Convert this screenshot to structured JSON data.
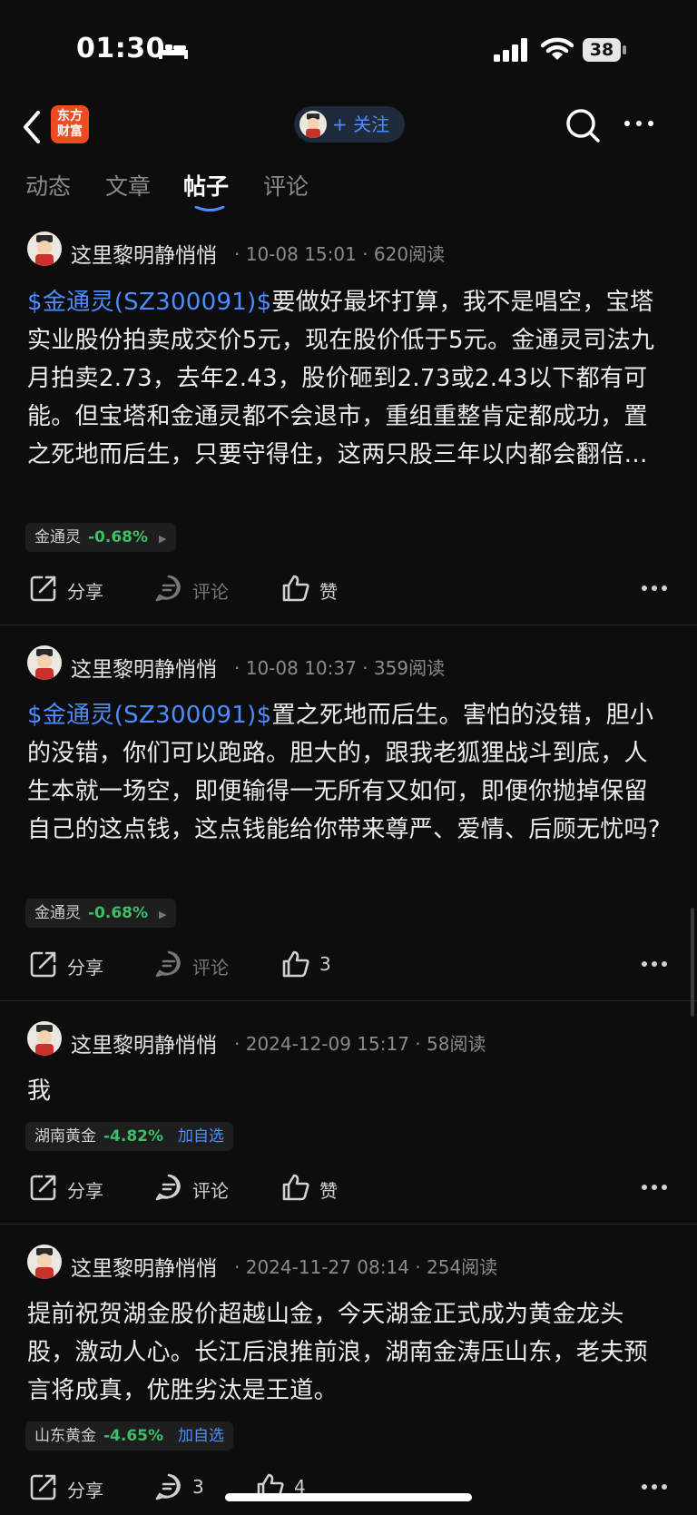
{
  "status_bar": {
    "time": "01:30",
    "battery": "38"
  },
  "nav": {
    "logo_line1": "东方",
    "logo_line2": "财富",
    "follow_label": "+ 关注"
  },
  "tabs": [
    {
      "label": "动态",
      "active": false
    },
    {
      "label": "文章",
      "active": false
    },
    {
      "label": "帖子",
      "active": true
    },
    {
      "label": "评论",
      "active": false
    }
  ],
  "colors": {
    "link": "#4d8dff",
    "down": "#3cbf66",
    "background": "#0d0d0d",
    "logo": "#ee4b22"
  },
  "posts": [
    {
      "author": "这里黎明静悄悄",
      "meta": "· 10-08 15:01 · 620阅读",
      "stock_link": "$金通灵(SZ300091)$",
      "text": "要做好最坏打算，我不是唱空，宝塔实业股份拍卖成交价5元，现在股价低于5元。金通灵司法九月拍卖2.73，去年2.43，股价砸到2.73或2.43以下都有可能。但宝塔和金通灵都不会退市，重组重整肯定都成功，置之死地而后生，只要守得住，这两只股三年以内都会翻倍。我只当存三年定期存款，三年后我必定能获得翻倍的收益",
      "tag": {
        "name": "金通灵",
        "change": "-0.68%",
        "add": ""
      },
      "actions": {
        "share": "分享",
        "comment": "评论",
        "like": "赞"
      }
    },
    {
      "author": "这里黎明静悄悄",
      "meta": "· 10-08 10:37 · 359阅读",
      "stock_link": "$金通灵(SZ300091)$",
      "text": "置之死地而后生。害怕的没错，胆小的没错，你们可以跑路。胆大的，跟我老狐狸战斗到底，人生本就一场空，即便输得一无所有又如何，即便你抛掉保留自己的这点钱，这点钱能给你带来尊严、爱情、后顾无忧吗?",
      "tag": {
        "name": "金通灵",
        "change": "-0.68%",
        "add": ""
      },
      "actions": {
        "share": "分享",
        "comment": "评论",
        "like": "3"
      }
    },
    {
      "author": "这里黎明静悄悄",
      "meta": "· 2024-12-09 15:17 · 58阅读",
      "stock_link": "",
      "text": "我",
      "tag": {
        "name": "湖南黄金",
        "change": "-4.82%",
        "add": "加自选"
      },
      "actions": {
        "share": "分享",
        "comment": "评论",
        "like": "赞"
      }
    },
    {
      "author": "这里黎明静悄悄",
      "meta": "· 2024-11-27 08:14 · 254阅读",
      "stock_link": "",
      "text": "提前祝贺湖金股价超越山金，今天湖金正式成为黄金龙头股，激动人心。长江后浪推前浪，湖南金涛压山东，老夫预言将成真，优胜劣汰是王道。",
      "tag": {
        "name": "山东黄金",
        "change": "-4.65%",
        "add": "加自选"
      },
      "actions": {
        "share": "分享",
        "comment": "3",
        "like": "4"
      }
    }
  ]
}
